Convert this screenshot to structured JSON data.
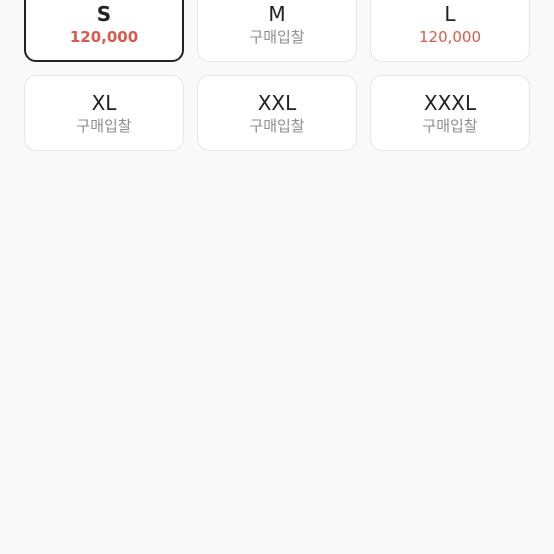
{
  "colors": {
    "background": "#f9f9f9",
    "card": "#ffffff",
    "card_border": "#e6e6e6",
    "selected_border": "#222222",
    "price": "#d9594c",
    "muted": "#8e8e8e",
    "text": "#222222"
  },
  "sizes": [
    {
      "label": "S",
      "sub": "120,000",
      "sub_type": "price",
      "selected": true
    },
    {
      "label": "M",
      "sub": "구매입찰",
      "sub_type": "bid",
      "selected": false
    },
    {
      "label": "L",
      "sub": "120,000",
      "sub_type": "price",
      "selected": false
    },
    {
      "label": "XL",
      "sub": "구매입찰",
      "sub_type": "bid",
      "selected": false
    },
    {
      "label": "XXL",
      "sub": "구매입찰",
      "sub_type": "bid",
      "selected": false
    },
    {
      "label": "XXXL",
      "sub": "구매입찰",
      "sub_type": "bid",
      "selected": false
    }
  ]
}
